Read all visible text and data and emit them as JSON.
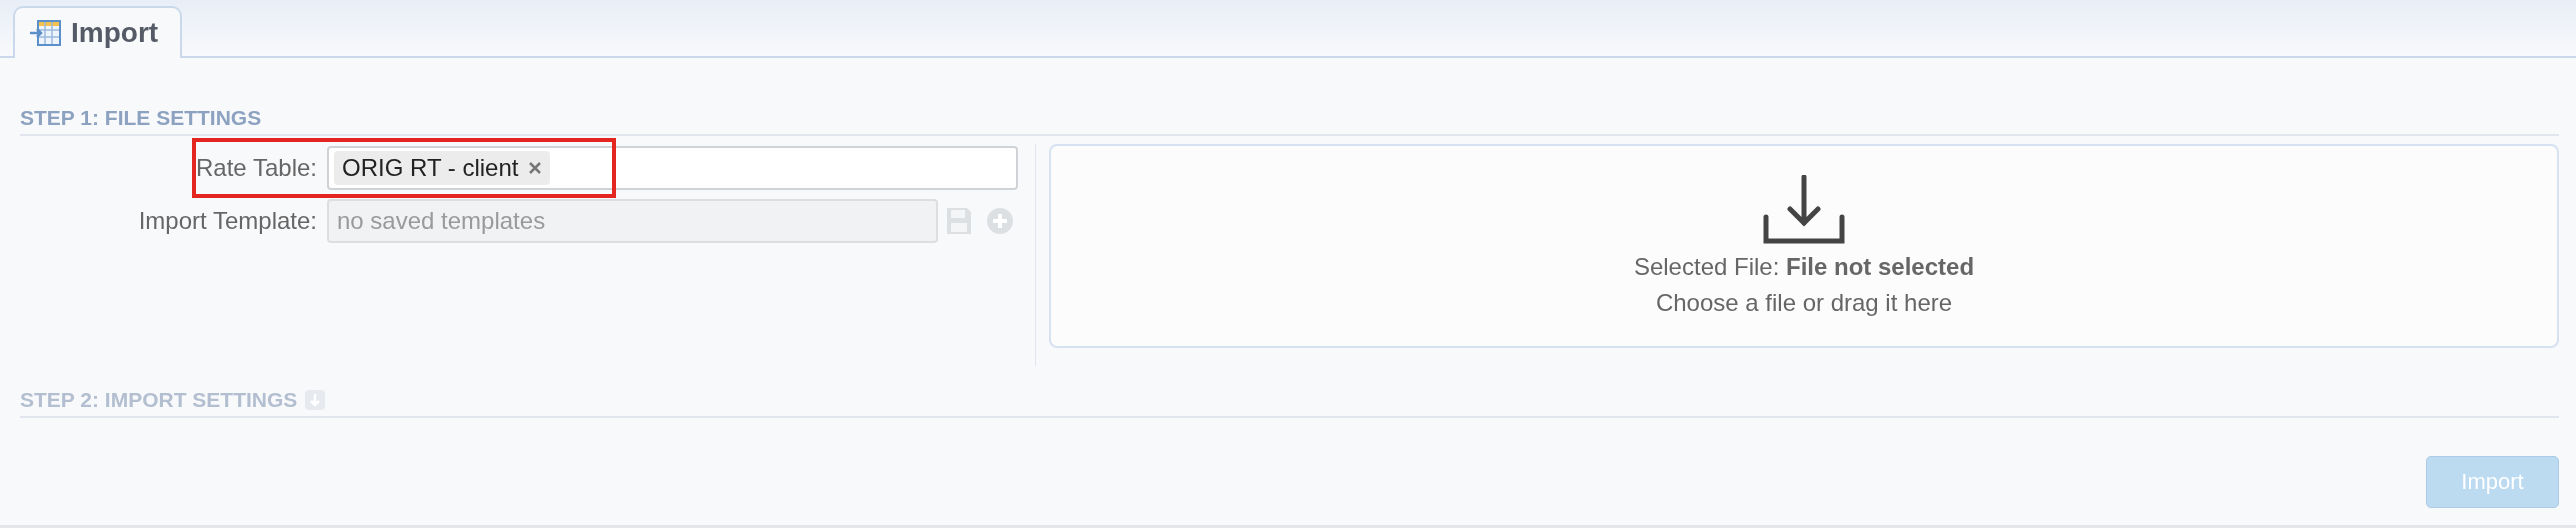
{
  "tabs": [
    {
      "label": "Import",
      "selected": true
    }
  ],
  "step1": {
    "title": "STEP 1: FILE SETTINGS",
    "rate_table": {
      "label": "Rate Table:",
      "chips": [
        "ORIG RT - client"
      ],
      "highlighted": true
    },
    "import_template": {
      "label": "Import Template:",
      "placeholder": "no saved templates",
      "disabled": true
    },
    "drop_zone": {
      "selected_label": "Selected File:",
      "selected_value": "File not selected",
      "hint": "Choose a file or drag it here"
    }
  },
  "step2": {
    "title": "STEP 2: IMPORT SETTINGS",
    "disabled": true
  },
  "import_button": {
    "label": "Import",
    "disabled": true
  }
}
